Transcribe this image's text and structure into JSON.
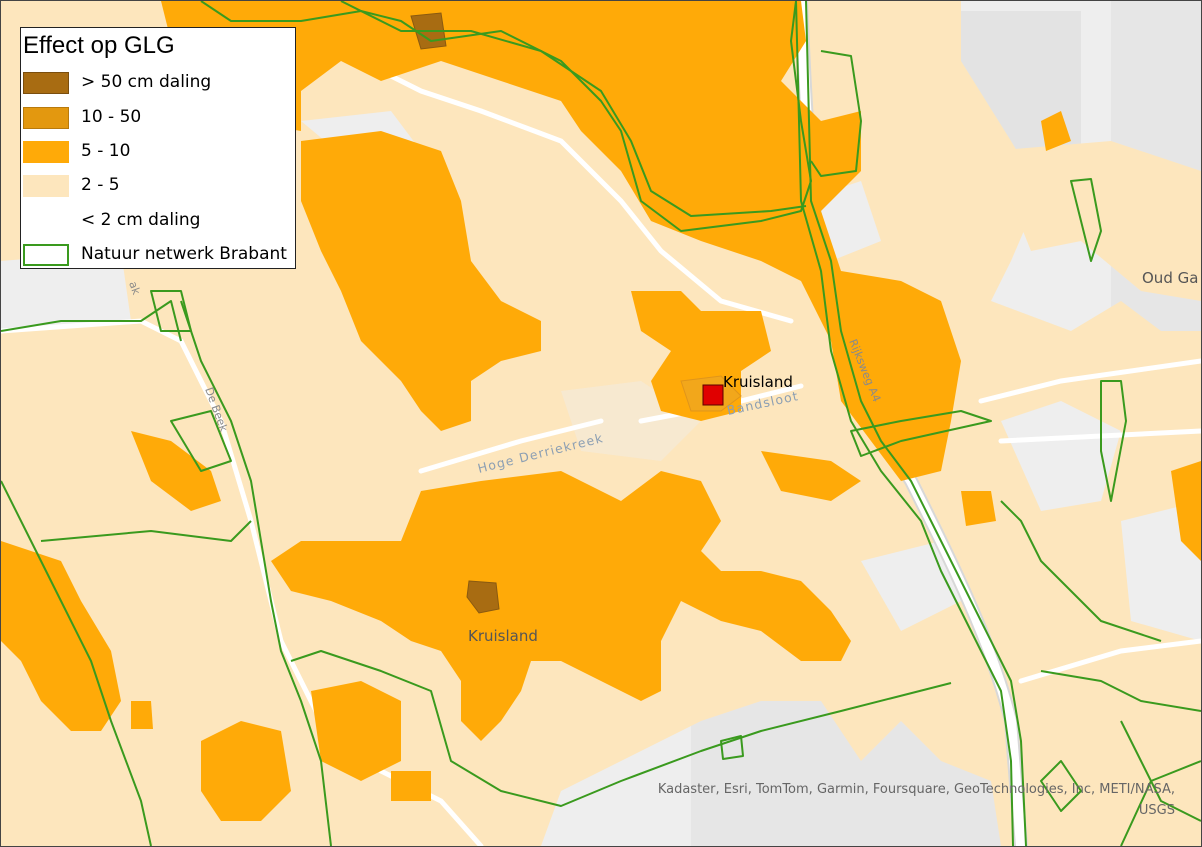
{
  "legend": {
    "title": "Effect op GLG",
    "items": [
      {
        "label": "> 50 cm daling",
        "fill": "#a86c12",
        "stroke": "#7a4e0e"
      },
      {
        "label": "10 - 50",
        "fill": "#e3980f",
        "stroke": "#b87a0c"
      },
      {
        "label": "5 - 10",
        "fill": "#ffaa08",
        "stroke": "#ffaa08"
      },
      {
        "label": "2 - 5",
        "fill": "#fde6bd",
        "stroke": "#fde6bd"
      },
      {
        "label": "< 2 cm daling",
        "fill": "#ffffff",
        "stroke": "#ffffff"
      },
      {
        "label": "Natuur netwerk Brabant",
        "fill": "#ffffff",
        "stroke": "#3a9a1e"
      }
    ]
  },
  "labels": {
    "place_kruisland": "Kruisland",
    "town_marker": "Kruisland",
    "water_hoge_derriekreek": "Hoge Derriekreek",
    "water_bandsloot": "Bandsloot",
    "oud_gastel": "Oud Ga",
    "road_debeek": "De Beek",
    "road_rijksweg": "Rijksweg A4",
    "road_lak": "ak"
  },
  "marker": {
    "color": "#e00000"
  },
  "attribution": {
    "line1": "Kadaster, Esri, TomTom, Garmin, Foursquare, GeoTechnologies, Inc, METI/NASA,",
    "line2": "USGS"
  },
  "colors": {
    "basemap": "#eeeeee",
    "nnb_outline": "#3a9a1e"
  }
}
